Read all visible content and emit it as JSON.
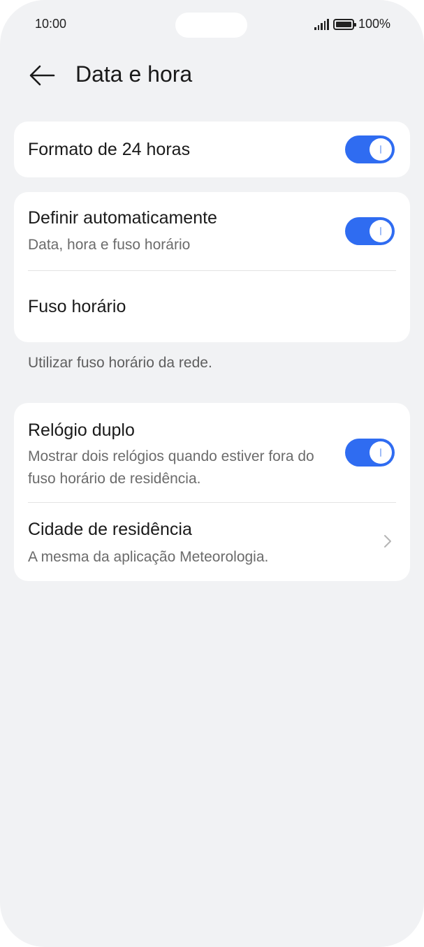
{
  "status_bar": {
    "time": "10:00",
    "battery": "100%",
    "signal_icon": "signal-icon",
    "battery_icon": "battery-icon"
  },
  "header": {
    "title": "Data e hora",
    "back_icon": "arrow-left-icon"
  },
  "format_card": {
    "title": "Formato de 24 horas",
    "toggle_on": true
  },
  "auto_card": {
    "auto_title": "Definir automaticamente",
    "auto_subtitle": "Data, hora e fuso horário",
    "auto_toggle_on": true,
    "timezone_title": "Fuso horário"
  },
  "network_note": "Utilizar fuso horário da rede.",
  "dual_card": {
    "dual_title": "Relógio duplo",
    "dual_subtitle": "Mostrar dois relógios quando estiver fora do fuso horário de residência.",
    "dual_toggle_on": true,
    "home_title": "Cidade de residência",
    "home_subtitle": "A mesma da aplicação Meteorologia.",
    "home_chevron_icon": "chevron-right-icon"
  },
  "colors": {
    "accent": "#2f6cf1",
    "background": "#f1f2f4",
    "card": "#ffffff"
  }
}
